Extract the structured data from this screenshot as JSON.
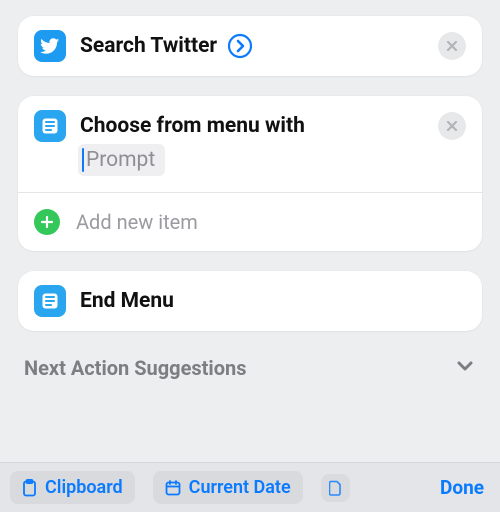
{
  "actions": {
    "search_twitter": {
      "title": "Search Twitter"
    },
    "choose_menu": {
      "title": "Choose from menu with",
      "prompt_placeholder": "Prompt",
      "add_item_label": "Add new item"
    },
    "end_menu": {
      "title": "End Menu"
    }
  },
  "suggestions": {
    "header": "Next Action Suggestions",
    "items": [
      "Clipboard",
      "Current Date"
    ]
  },
  "keyboard": {
    "done": "Done"
  },
  "colors": {
    "accent": "#0a7aff",
    "green": "#34c759",
    "twitter": "#1d9bf0"
  }
}
